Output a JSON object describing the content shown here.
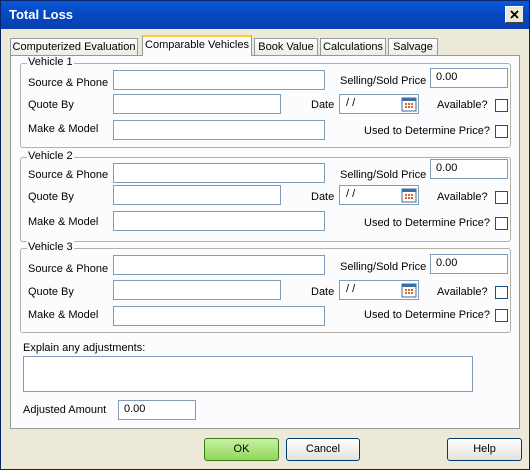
{
  "window": {
    "title": "Total Loss"
  },
  "tabs": [
    "Computerized Evaluation",
    "Comparable Vehicles",
    "Book Value",
    "Calculations",
    "Salvage"
  ],
  "active_tab": "Comparable Vehicles",
  "labels": {
    "source_phone": "Source & Phone",
    "quote_by": "Quote By",
    "make_model": "Make & Model",
    "selling_price": "Selling/Sold Price",
    "date": "Date",
    "available": "Available?",
    "used_to_determine": "Used to Determine Price?"
  },
  "vehicles": [
    {
      "title": "Vehicle 1",
      "price": "0.00",
      "date_placeholder": "/  /"
    },
    {
      "title": "Vehicle 2",
      "price": "0.00",
      "date_placeholder": "/  /"
    },
    {
      "title": "Vehicle 3",
      "price": "0.00",
      "date_placeholder": "/  /"
    }
  ],
  "adjustments": {
    "label": "Explain any adjustments:"
  },
  "adjusted_amount": {
    "label": "Adjusted Amount",
    "value": "0.00"
  },
  "buttons": {
    "ok": "OK",
    "cancel": "Cancel",
    "help": "Help"
  }
}
